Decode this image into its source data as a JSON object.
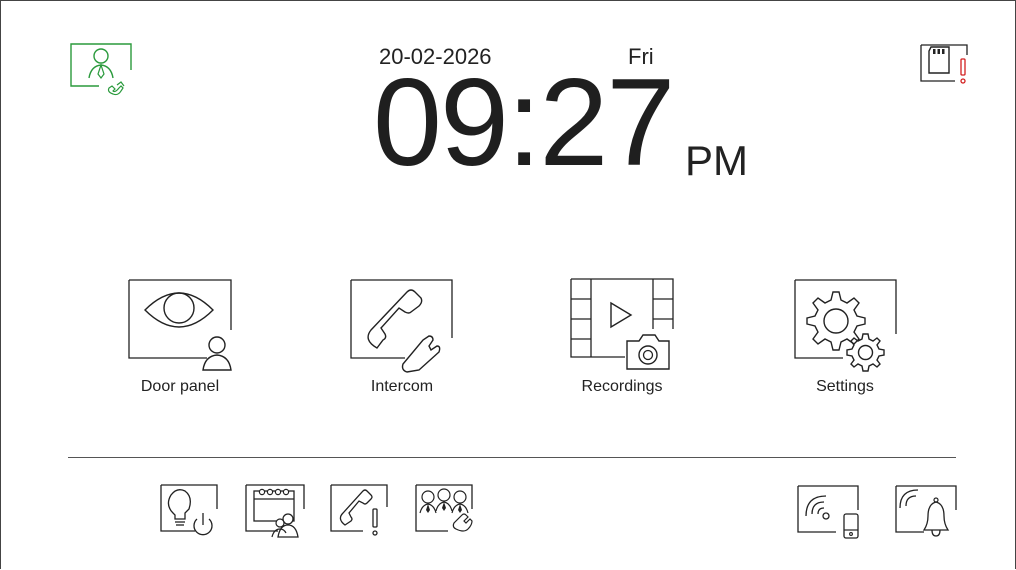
{
  "header": {
    "date": "20-02-2026",
    "day": "Fri",
    "time": "09:27",
    "ampm": "PM"
  },
  "status": {
    "left_icon": "doorman-call-icon",
    "right_icon": "sd-card-alert-icon",
    "accent_color": "#2a9a3c",
    "alert_color": "#d21f1f"
  },
  "menu": {
    "items": [
      {
        "label": "Door panel",
        "icon": "door-panel-eye-icon"
      },
      {
        "label": "Intercom",
        "icon": "intercom-handset-icon"
      },
      {
        "label": "Recordings",
        "icon": "recordings-film-camera-icon"
      },
      {
        "label": "Settings",
        "icon": "settings-gears-icon"
      }
    ]
  },
  "bottom_bar": {
    "left_icons": [
      "light-power-icon",
      "calendar-users-icon",
      "missed-call-icon",
      "group-call-icon"
    ],
    "right_icons": [
      "wifi-phone-icon",
      "wireless-bell-icon"
    ]
  }
}
